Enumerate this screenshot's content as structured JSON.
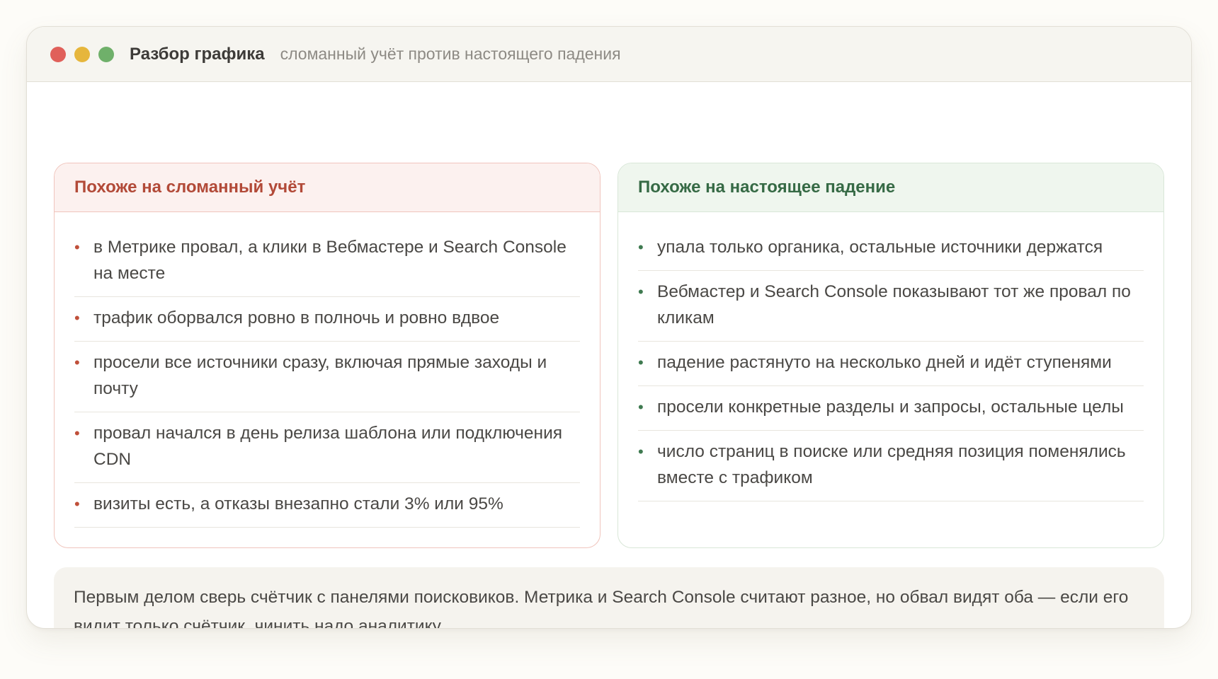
{
  "window": {
    "title": "Разбор графика",
    "subtitle": "сломанный учёт против настоящего падения",
    "controls": [
      "close",
      "minimize",
      "maximize"
    ]
  },
  "broken_tracking": {
    "heading": "Похоже на сломанный учёт",
    "items": [
      "в Метрике провал, а клики в Вебмастере и Search Console на месте",
      "трафик оборвался ровно в полночь и ровно вдвое",
      "просели все источники сразу, включая прямые заходы и почту",
      "провал начался в день релиза шаблона или подключения CDN",
      "визиты есть, а отказы внезапно стали 3% или 95%"
    ]
  },
  "real_drop": {
    "heading": "Похоже на настоящее падение",
    "items": [
      "упала только органика, остальные источники держатся",
      "Вебмастер и Search Console показывают тот же провал по кликам",
      "падение растянуто на несколько дней и идёт ступенями",
      "просели конкретные разделы и запросы, остальные целы",
      "число страниц в поиске или средняя позиция поменялись вместе с трафиком"
    ]
  },
  "note": {
    "text": "Первым делом сверь счётчик с панелями поисковиков. Метрика и Search Console считают разное, но обвал видят оба — если его видит только счётчик, чинить надо аналитику."
  },
  "colors": {
    "broken_accent": "#b24a38",
    "real_accent": "#366a45",
    "close_dot": "#e0605a",
    "minimize_dot": "#e6b63c",
    "maximize_dot": "#6fb06a"
  }
}
